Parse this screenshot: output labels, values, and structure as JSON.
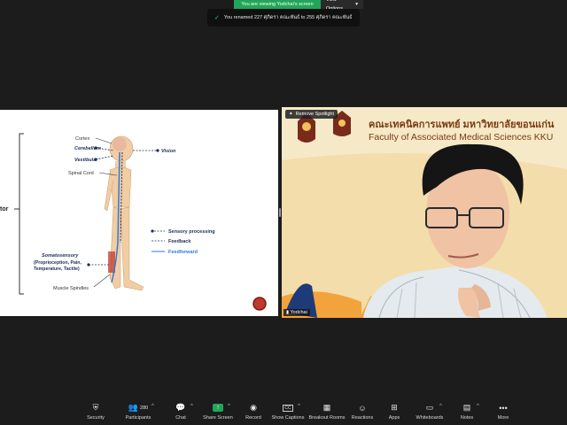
{
  "banner": {
    "viewing": "You are viewing Yodchai's screen",
    "view_options": "View Options"
  },
  "notification": {
    "text": "You renamed 227 ศุภิดรา คณะพันธ์ to 255 ศุภิดรา คณะพันธ์"
  },
  "slide": {
    "cut_label": "tor",
    "labels": {
      "cortex": "Cortex",
      "cerebellum": "Cerebellum",
      "vestibular": "Vestibular",
      "vision": "Vision",
      "spinal_cord": "Spinal Cord",
      "somatosensory": "Somatosensory",
      "soma_detail1": "(Proprioception, Pain,",
      "soma_detail2": "Temperature, Tactile)",
      "muscle_spindles": "Muscle Spindles"
    },
    "legend": {
      "sensory": "Sensory processing",
      "feedback": "Feedback",
      "feedforward": "Feedforward"
    }
  },
  "video": {
    "spotlight": "Remove Spotlight",
    "participant_name": "Yodchai",
    "title_th": "คณะเทคนิคการแพทย์ มหาวิทยาลัยขอนแก่น",
    "title_en": "Faculty of Associated Medical Sciences KKU"
  },
  "toolbar": {
    "security": "Security",
    "participants": "Participants",
    "participants_count": "280",
    "chat": "Chat",
    "share": "Share Screen",
    "record": "Record",
    "captions": "Show Captions",
    "captions_icon_text": "CC",
    "breakout": "Breakout Rooms",
    "reactions": "Reactions",
    "apps": "Apps",
    "whiteboards": "Whiteboards",
    "notes": "Notes",
    "more": "More"
  },
  "colors": {
    "share_green": "#23a559",
    "legend_navy": "#1f2d5a",
    "feedforward_blue": "#2f7ad6",
    "brand_brown": "#7a3b12"
  }
}
